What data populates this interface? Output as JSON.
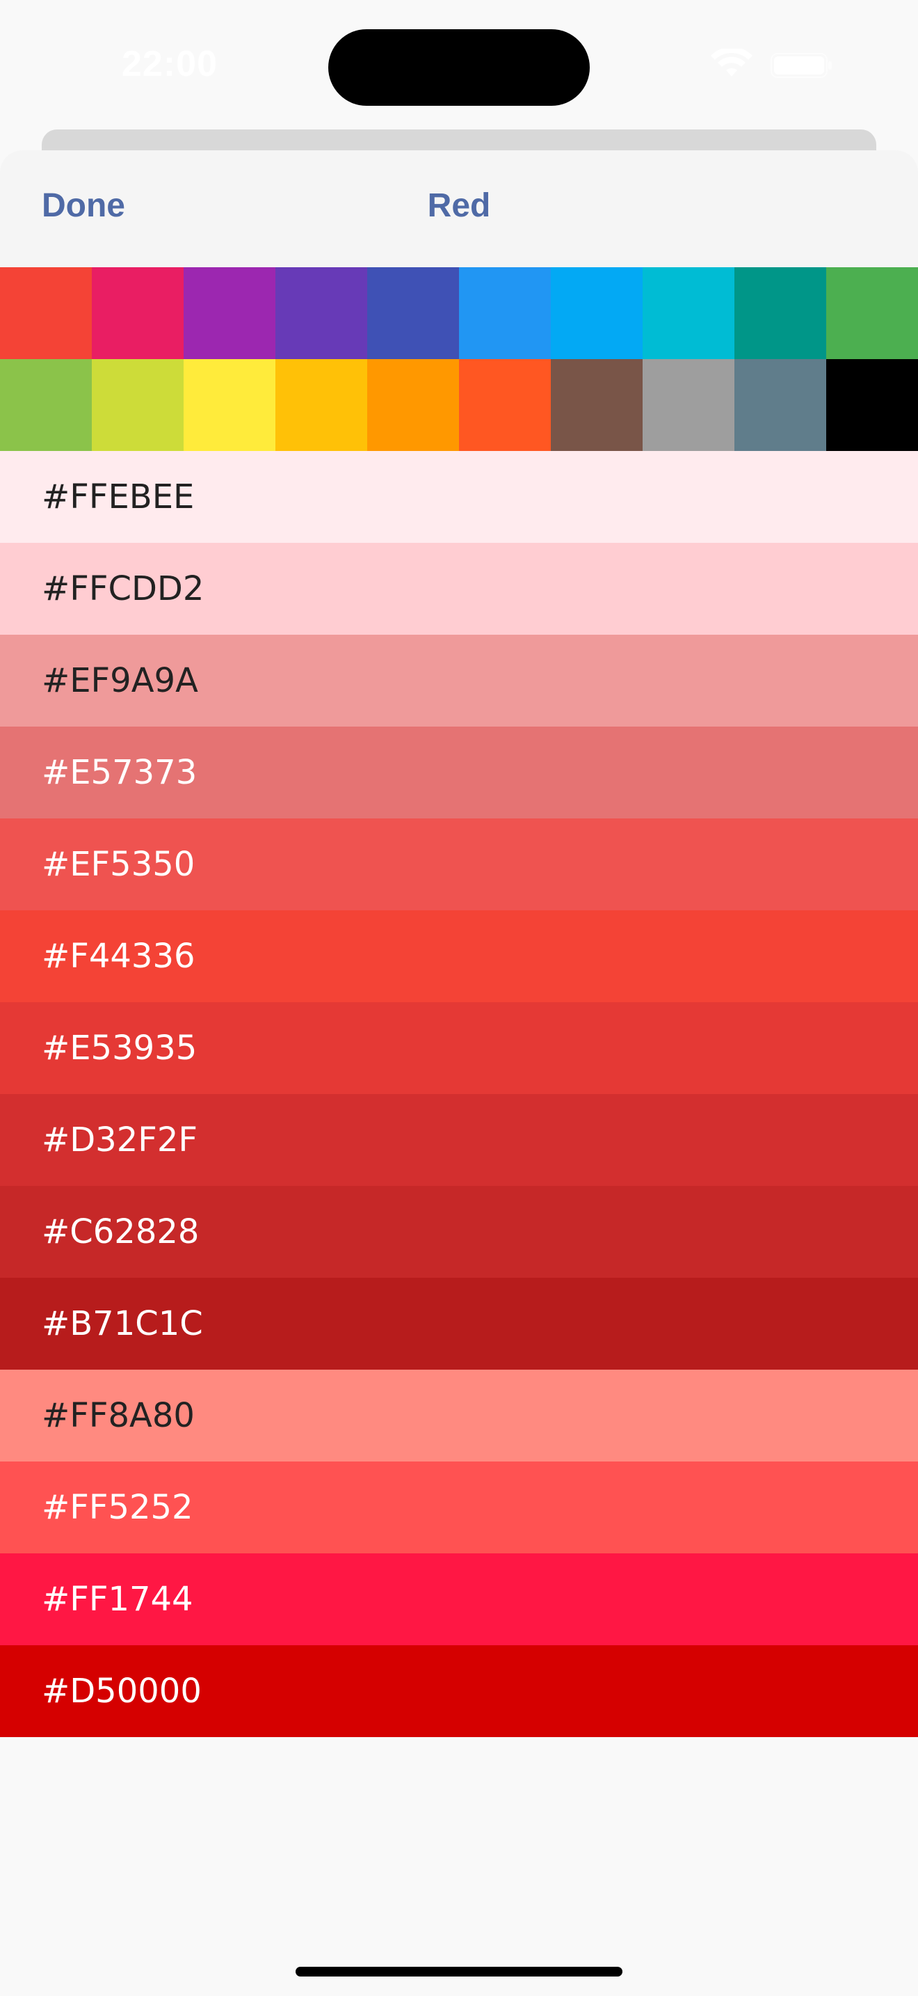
{
  "status_bar": {
    "time": "22:00",
    "icons": [
      "wifi-icon",
      "battery-icon"
    ]
  },
  "nav": {
    "done_label": "Done",
    "title": "Red"
  },
  "accent_color": "#4f6aa6",
  "palette": {
    "row1": [
      "#F44336",
      "#E91E63",
      "#9C27B0",
      "#673AB7",
      "#3F51B5",
      "#2196F3",
      "#03A9F4",
      "#00BCD4",
      "#009688",
      "#4CAF50"
    ],
    "row2": [
      "#8BC34A",
      "#CDDC39",
      "#FFEB3B",
      "#FFC107",
      "#FF9800",
      "#FF5722",
      "#795548",
      "#9E9E9E",
      "#607D8B",
      "#000000"
    ]
  },
  "shades": [
    {
      "label": "#FFEBEE",
      "color": "#FFEBEE",
      "text_color": "#222222"
    },
    {
      "label": "#FFCDD2",
      "color": "#FFCDD2",
      "text_color": "#222222"
    },
    {
      "label": "#EF9A9A",
      "color": "#EF9A9A",
      "text_color": "#222222"
    },
    {
      "label": "#E57373",
      "color": "#E57373",
      "text_color": "#ffffff"
    },
    {
      "label": "#EF5350",
      "color": "#EF5350",
      "text_color": "#ffffff"
    },
    {
      "label": "#F44336",
      "color": "#F44336",
      "text_color": "#ffffff"
    },
    {
      "label": "#E53935",
      "color": "#E53935",
      "text_color": "#ffffff"
    },
    {
      "label": "#D32F2F",
      "color": "#D32F2F",
      "text_color": "#ffffff"
    },
    {
      "label": "#C62828",
      "color": "#C62828",
      "text_color": "#ffffff"
    },
    {
      "label": "#B71C1C",
      "color": "#B71C1C",
      "text_color": "#ffffff"
    },
    {
      "label": "#FF8A80",
      "color": "#FF8A80",
      "text_color": "#222222"
    },
    {
      "label": "#FF5252",
      "color": "#FF5252",
      "text_color": "#ffffff"
    },
    {
      "label": "#FF1744",
      "color": "#FF1744",
      "text_color": "#ffffff"
    },
    {
      "label": "#D50000",
      "color": "#D50000",
      "text_color": "#ffffff"
    }
  ]
}
